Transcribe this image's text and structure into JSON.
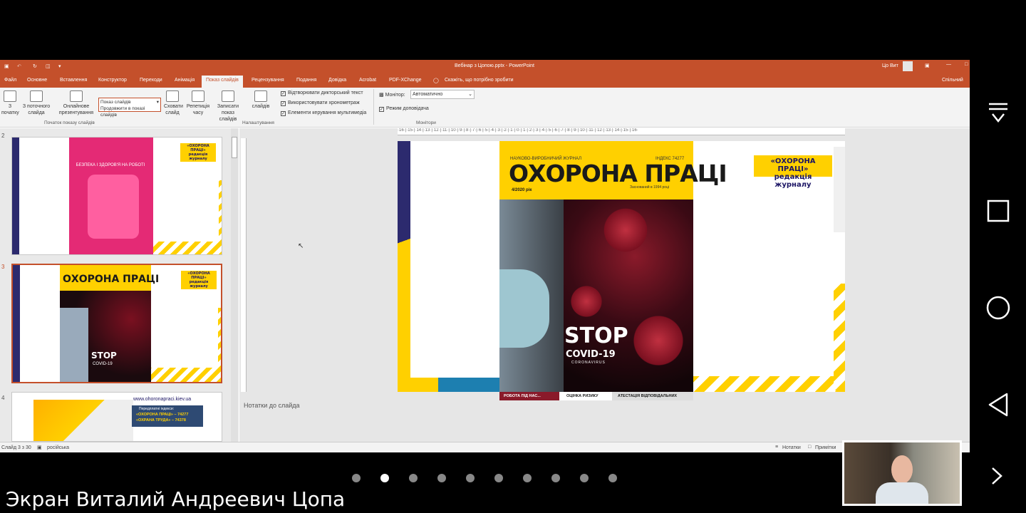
{
  "window": {
    "title": "Вебінар з Цопою.pptx - PowerPoint",
    "user": "Цо Вит"
  },
  "tabs": [
    {
      "label": "Файл",
      "active": false
    },
    {
      "label": "Основне",
      "active": false
    },
    {
      "label": "Вставлення",
      "active": false
    },
    {
      "label": "Конструктор",
      "active": false
    },
    {
      "label": "Переходи",
      "active": false
    },
    {
      "label": "Анімація",
      "active": false
    },
    {
      "label": "Показ слайдів",
      "active": true
    },
    {
      "label": "Рецензування",
      "active": false
    },
    {
      "label": "Подання",
      "active": false
    },
    {
      "label": "Довідка",
      "active": false
    },
    {
      "label": "Acrobat",
      "active": false
    },
    {
      "label": "PDF-XChange",
      "active": false
    }
  ],
  "tell_me": "Скажіть, що потрібно зробити",
  "share": "Спільний",
  "ribbon": {
    "from_beginning": "З початку",
    "from_current": "З поточного слайда",
    "online": "Онлайнове презентування",
    "custom": "Показ слайдів",
    "custom_sub": "Продовжити в показі слайдів",
    "hide": "Сховати слайд",
    "hide2": "слайдів",
    "rehearse": "Репетиція часу",
    "record": "Записати показ слайдів",
    "group_start": "Початок показу слайдів",
    "group_setup": "Налаштування",
    "chk_narration": "Відтворювати дикторський текст",
    "chk_timings": "Використовувати хронометраж",
    "chk_media": "Елементи керування мультимедіа",
    "monitor_label": "Монітор:",
    "monitor_value": "Автоматично",
    "presenter_view": "Режим доповідача",
    "group_monitors": "Монітори"
  },
  "thumbnails": [
    {
      "num": "2",
      "title": "БЕЗПЕКА І ЗДОРОВ'Я НА РОБОТІ",
      "badge": "«ОХОРОНА ПРАЦІ» редакція журналу"
    },
    {
      "num": "3",
      "title": "ОХОРОНА ПРАЦІ",
      "badge": "«ОХОРОНА ПРАЦІ» редакція журналу",
      "stop": "STOP",
      "covid": "COVID-19"
    },
    {
      "num": "4",
      "url": "www.ohoronapraci.kiev.ua",
      "line1": "Передплатні індекси:",
      "line2": "«ОХОРОНА ПРАЦІ» – 74277",
      "line3": "«ОХРАНА ТРУДА» – 74378"
    }
  ],
  "slide": {
    "magazine_kicker": "НАУКОВО-ВИРОБНИЧИЙ ЖУРНАЛ",
    "index": "ІНДЕКС 74277",
    "title": "ОХОРОНА ПРАЦІ",
    "issue": "4/2020 рік",
    "founded": "Заснований в 1994 році",
    "stop": "STOP",
    "covid": "COVID-19",
    "coronavirus": "CORONAVIRUS",
    "badge1": "«ОХОРОНА ПРАЦІ»",
    "badge2": "редакція журналу",
    "strip1": "РОБОТА ПІД НАС...",
    "strip2": "ОЦІНКА РИЗИКУ",
    "strip3": "АТЕСТАЦІЯ ВІДПОВІДАЛЬНИХ"
  },
  "notes_placeholder": "Нотатки до слайда",
  "status": {
    "slide": "Слайд 3 з 30",
    "lang": "російська",
    "notes": "Нотатки",
    "comments": "Примітки"
  },
  "caption": "Экран Виталий Андреевич Цопа",
  "pager": {
    "total": 10,
    "active": 1
  },
  "colors": {
    "ppt_accent": "#c4502b",
    "yellow": "#ffd000",
    "navy": "#1b1464"
  }
}
